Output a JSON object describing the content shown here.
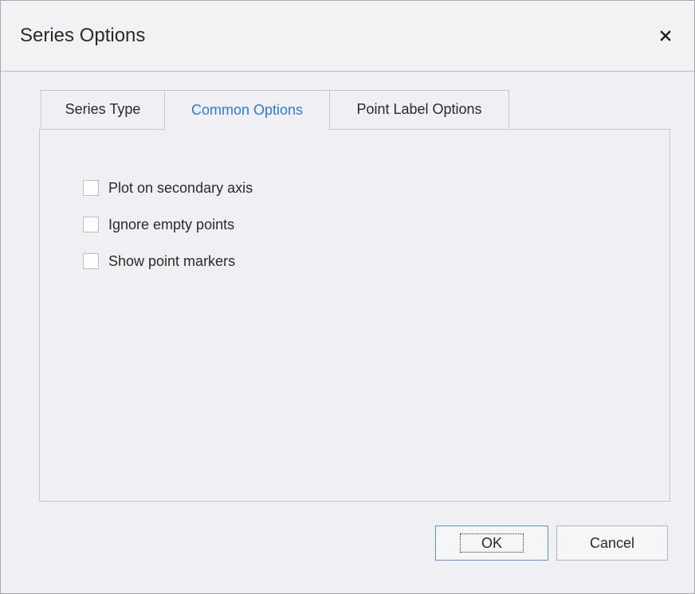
{
  "dialog": {
    "title": "Series Options",
    "close_icon": "close-icon"
  },
  "tabs": [
    {
      "label": "Series Type",
      "active": false
    },
    {
      "label": "Common Options",
      "active": true
    },
    {
      "label": "Point Label Options",
      "active": false
    }
  ],
  "options": [
    {
      "label": "Plot on secondary axis",
      "checked": false
    },
    {
      "label": "Ignore empty points",
      "checked": false
    },
    {
      "label": "Show point markers",
      "checked": false
    }
  ],
  "buttons": {
    "ok_label": "OK",
    "cancel_label": "Cancel"
  },
  "colors": {
    "active_tab_text": "#2b7bd6",
    "ok_border": "#5a8ed8"
  }
}
